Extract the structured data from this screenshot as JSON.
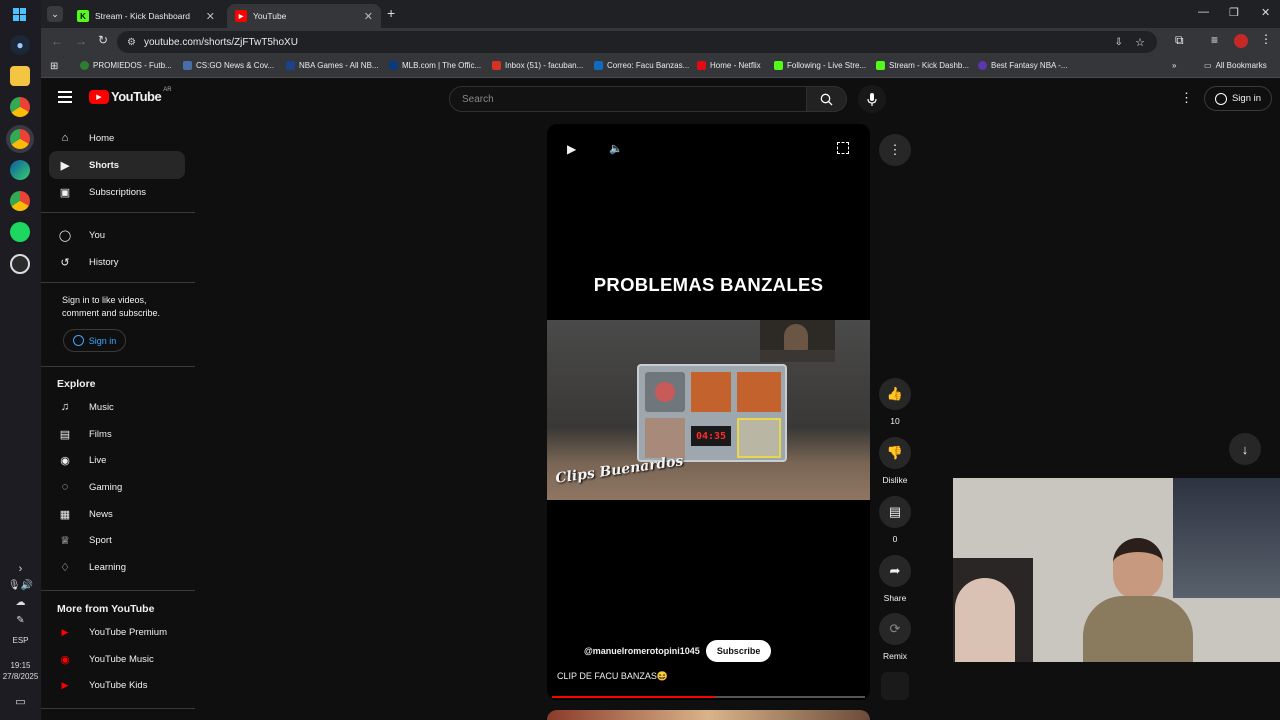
{
  "browser": {
    "tabs": [
      {
        "title": "Stream - Kick Dashboard",
        "active": false
      },
      {
        "title": "YouTube",
        "active": true
      }
    ],
    "url": "youtube.com/shorts/ZjFTwT5hoXU",
    "bookmarks": [
      "PROMIEDOS - Futb...",
      "CS:GO News & Cov...",
      "NBA Games - All NB...",
      "MLB.com | The Offic...",
      "Inbox (51) - facuban...",
      "Correo: Facu Banzas...",
      "Home - Netflix",
      "Following - Live Stre...",
      "Stream - Kick Dashb...",
      "Best Fantasy NBA -..."
    ],
    "all_bookmarks": "All Bookmarks"
  },
  "taskbar": {
    "lang": "ESP",
    "time": "19:15",
    "date": "27/8/2025"
  },
  "youtube": {
    "logo": "YouTube",
    "region": "AR",
    "search_placeholder": "Search",
    "sign_in": "Sign in",
    "nav_main": [
      {
        "label": "Home",
        "icon": "home-icon"
      },
      {
        "label": "Shorts",
        "icon": "shorts-icon",
        "active": true
      },
      {
        "label": "Subscriptions",
        "icon": "subscriptions-icon"
      }
    ],
    "nav_you": [
      {
        "label": "You",
        "icon": "user-icon"
      },
      {
        "label": "History",
        "icon": "history-icon"
      }
    ],
    "signin_prompt": "Sign in to like videos, comment and subscribe.",
    "signin_button": "Sign in",
    "explore_title": "Explore",
    "explore": [
      {
        "label": "Music",
        "icon": "music-icon"
      },
      {
        "label": "Films",
        "icon": "film-icon"
      },
      {
        "label": "Live",
        "icon": "live-icon"
      },
      {
        "label": "Gaming",
        "icon": "gaming-icon"
      },
      {
        "label": "News",
        "icon": "news-icon"
      },
      {
        "label": "Sport",
        "icon": "trophy-icon"
      },
      {
        "label": "Learning",
        "icon": "learning-icon"
      }
    ],
    "more_title": "More from YouTube",
    "more": [
      {
        "label": "YouTube Premium"
      },
      {
        "label": "YouTube Music"
      },
      {
        "label": "YouTube Kids"
      }
    ]
  },
  "short": {
    "overlay_title": "PROBLEMAS BANZALES",
    "timer": "04:35",
    "watermark": "Clips Buenardos",
    "channel": "@manuelromerotopini1045",
    "subscribe": "Subscribe",
    "caption": "CLIP DE FACU BANZAS😆",
    "progress": 0.52,
    "likes": "10",
    "dislike": "Dislike",
    "comments": "0",
    "share": "Share",
    "remix": "Remix"
  },
  "colors": {
    "youtube_red": "#ff0000",
    "kick_green": "#53fc18",
    "bg": "#0f0f0f",
    "active_item": "#272727"
  }
}
